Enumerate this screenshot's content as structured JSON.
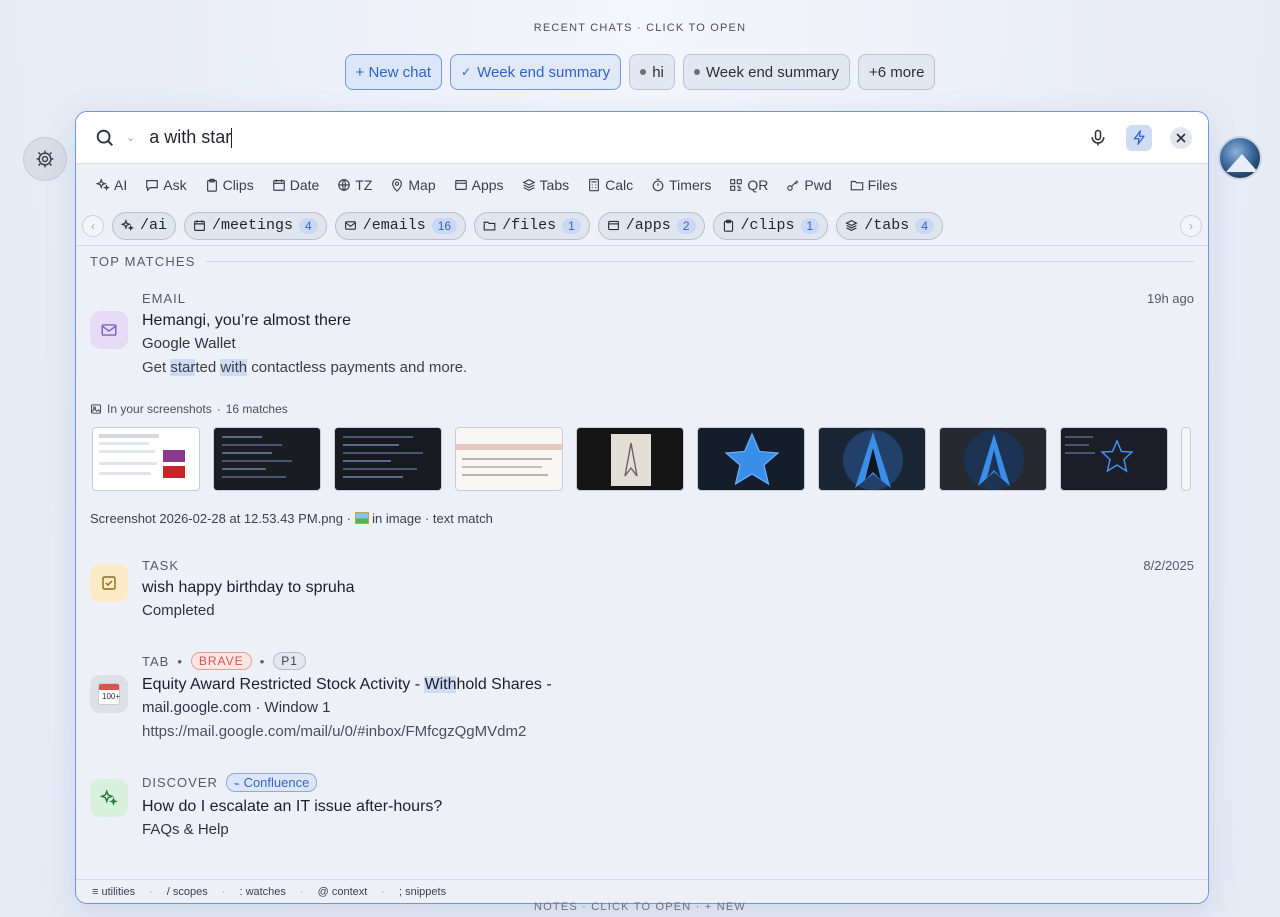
{
  "recent": {
    "title": "RECENT CHATS · CLICK TO OPEN",
    "chips": [
      {
        "label": "+ New chat"
      },
      {
        "label": "Week end summary",
        "prefix": "✓"
      },
      {
        "label": "hi"
      },
      {
        "label": "Week end summary"
      },
      {
        "label": "+6 more"
      }
    ]
  },
  "search": {
    "value": "a with star"
  },
  "filters": [
    {
      "label": "AI",
      "icon": "sparkle-icon"
    },
    {
      "label": "Ask",
      "icon": "chat-icon"
    },
    {
      "label": "Clips",
      "icon": "clipboard-icon"
    },
    {
      "label": "Date",
      "icon": "calendar-icon"
    },
    {
      "label": "TZ",
      "icon": "globe-icon"
    },
    {
      "label": "Map",
      "icon": "pin-icon"
    },
    {
      "label": "Apps",
      "icon": "window-icon"
    },
    {
      "label": "Tabs",
      "icon": "layers-icon"
    },
    {
      "label": "Calc",
      "icon": "calculator-icon"
    },
    {
      "label": "Timers",
      "icon": "timer-icon"
    },
    {
      "label": "QR",
      "icon": "qr-icon"
    },
    {
      "label": "Pwd",
      "icon": "key-icon"
    },
    {
      "label": "Files",
      "icon": "folder-icon"
    }
  ],
  "scopes": [
    {
      "label": "/ai",
      "count": ""
    },
    {
      "label": "/meetings",
      "count": "4"
    },
    {
      "label": "/emails",
      "count": "16"
    },
    {
      "label": "/files",
      "count": "1"
    },
    {
      "label": "/apps",
      "count": "2"
    },
    {
      "label": "/clips",
      "count": "1"
    },
    {
      "label": "/tabs",
      "count": "4"
    }
  ],
  "section_title": "TOP MATCHES",
  "email": {
    "kind": "EMAIL",
    "time": "19h ago",
    "title": "Hemangi, you’re almost there",
    "sub": "Google Wallet",
    "desc_parts": [
      "Get ",
      "star",
      "ted ",
      "with",
      " contactless payments and more."
    ]
  },
  "screenshots": {
    "label": "In your screenshots",
    "count_text": "16 matches",
    "caption": "Screenshot 2026-02-28 at 12.53.43 PM.png",
    "in_image": "in image",
    "match_type": "text match"
  },
  "task": {
    "kind": "TASK",
    "time": "8/2/2025",
    "title": "wish happy birthday to spruha",
    "sub": "Completed"
  },
  "tab": {
    "kind": "TAB",
    "browser": "BRAVE",
    "priority": "P1",
    "title_parts": [
      "Equity Award Restricted Stock Activity - ",
      "With",
      "hold Shares -"
    ],
    "sub": "mail.google.com · Window 1",
    "url": "https://mail.google.com/mail/u/0/#inbox/FMfcgzQgMVdm2"
  },
  "discover": {
    "kind": "DISCOVER",
    "source": "Confluence",
    "title": "How do I escalate an IT issue after-hours?",
    "sub": "FAQs & Help"
  },
  "footer": [
    {
      "key": "≡",
      "label": "utilities"
    },
    {
      "key": "/",
      "label": "scopes"
    },
    {
      "key": ":",
      "label": "watches"
    },
    {
      "key": "@",
      "label": "context"
    },
    {
      "key": ";",
      "label": "snippets"
    }
  ],
  "notes": "NOTES · CLICK TO OPEN · + NEW",
  "colors": {
    "accent": "#2f62c8",
    "brave": "#d2564a",
    "highlight": "#cfdbf3"
  }
}
